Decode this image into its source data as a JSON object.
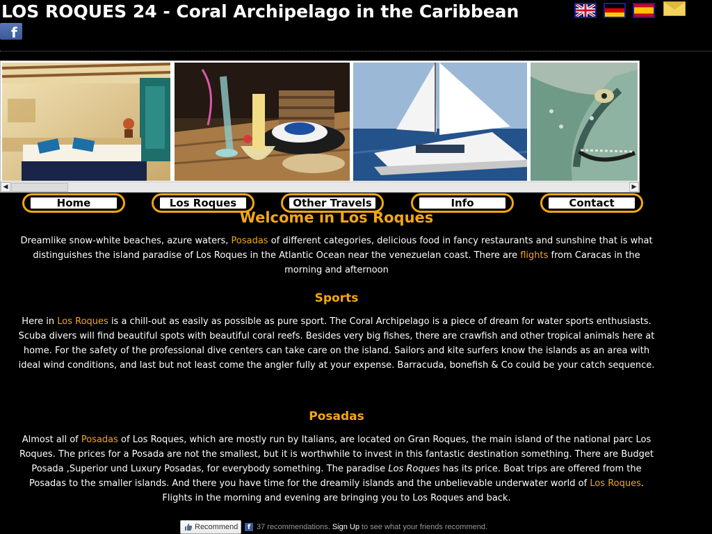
{
  "header": {
    "title": "LOS ROQUES 24 - Coral Archipelago in the Caribbean",
    "facebook_glyph": "f",
    "flags": [
      "uk-flag-icon",
      "germany-flag-icon",
      "spain-flag-icon"
    ],
    "contact_icon": "mail-icon"
  },
  "gallery": {
    "photos": [
      "posada-room-photo",
      "dinner-table-photo",
      "catamaran-photo",
      "fish-photo"
    ],
    "scroll_left": "◀",
    "scroll_right": "▶"
  },
  "nav": {
    "items": [
      "Home",
      "Los Roques",
      "Other Travels",
      "Info",
      "Contact"
    ]
  },
  "main": {
    "welcome_title": "Welcome in Los Roques",
    "intro": {
      "t1": "Dreamlike snow-white beaches, azure waters, ",
      "link1": "Posadas",
      "t2": " of different categories, delicious food in fancy restaurants and sunshine that is what distinguishes the island paradise of Los Roques in the Atlantic Ocean near the venezuelan coast. There are ",
      "link2": "flights",
      "t3": " from Caracas in the morning and afternoon"
    },
    "sports": {
      "title": "Sports",
      "t1": "Here in ",
      "link1": "Los Roques",
      "t2": " is a chill-out as easily as possible as pure sport. The Coral Archipelago is a piece of dream for water sports enthusiasts. Scuba divers will find beautiful spots with beautiful coral reefs. Besides very big fishes, there are crawfish and other tropical animals here at home. For the safety of the professional dive centers can take care on the island. Sailors and kite surfers know the islands as an area with ideal wind conditions, and last but not least come the angler fully at your expense. Barracuda, bonefish & Co could be your catch sequence."
    },
    "posadas": {
      "title": "Posadas",
      "t1": "Almost all of ",
      "link1": "Posadas",
      "t2": " of  Los Roques, which are mostly run by Italians, are located on Gran Roques, the main island of the national parc Los Roques. The prices for a Posada are not the smallest, but it is worthwhile to invest in this fantastic destination something. There are Budget Posada ,Superior und Luxury Posadas, for everybody something. The paradise ",
      "italic": "Los Roques",
      "t3": " has its price. Boat trips are offered from the Posadas to the smaller islands. And there you have time for the dreamily islands and the unbelievable underwater world of ",
      "link2": "Los Roques",
      "t4": ". Flights in the morning and evening are bringing you to Los Roques and back."
    }
  },
  "facebook_bar": {
    "button_label": "Recommend",
    "count_text": "37 recommendations.",
    "signup": "Sign Up",
    "tail": " to see what your friends recommend."
  },
  "colors": {
    "accent": "#f5a614",
    "background": "#000000",
    "text": "#ffffff",
    "facebook": "#3b5998"
  }
}
